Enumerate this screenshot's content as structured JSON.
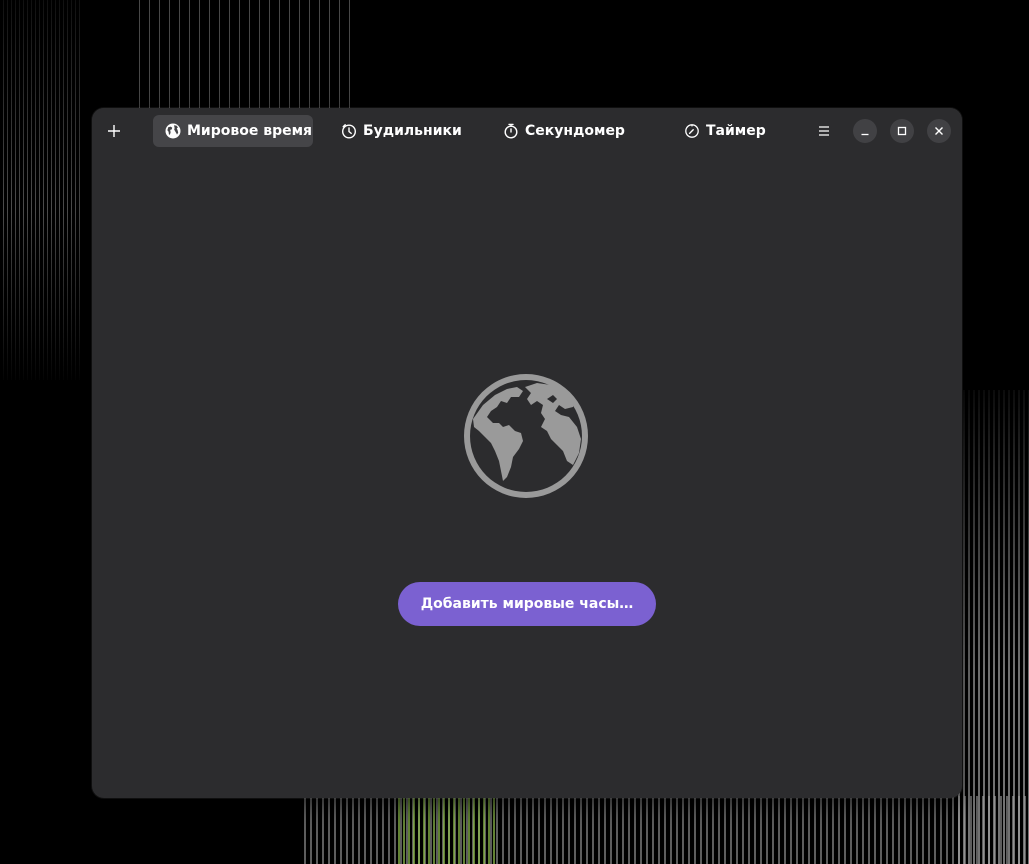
{
  "window": {
    "add_button_label": "+",
    "tabs": [
      {
        "label": "Мировое время",
        "icon": "globe-icon",
        "active": true
      },
      {
        "label": "Будильники",
        "icon": "alarm-clock-icon",
        "active": false
      },
      {
        "label": "Секундомер",
        "icon": "stopwatch-icon",
        "active": false
      },
      {
        "label": "Таймер",
        "icon": "timer-icon",
        "active": false
      }
    ],
    "menu_icon": "hamburger-menu-icon",
    "controls": {
      "minimize_icon": "minimize-icon",
      "maximize_icon": "maximize-icon",
      "close_icon": "close-icon"
    }
  },
  "empty_state": {
    "icon": "globe-icon",
    "button_label": "Добавить мировые часы…"
  },
  "colors": {
    "window_bg": "#2c2c2e",
    "active_tab_bg": "#454548",
    "accent": "#7b61d1",
    "icon_gray": "#9a9a9a",
    "desktop_bg": "#000000"
  }
}
